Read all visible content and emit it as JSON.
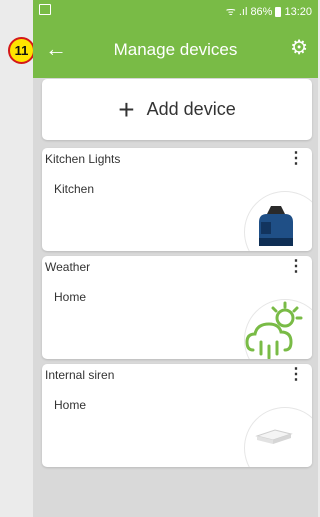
{
  "status_bar": {
    "signal": "ᯤ .ıl",
    "battery_pct": "86%",
    "time": "13:20"
  },
  "annotation": {
    "number": "11"
  },
  "app_bar": {
    "title": "Manage devices"
  },
  "add_device": {
    "label": "Add device"
  },
  "devices": [
    {
      "name": "Kitchen Lights",
      "location": "Kitchen",
      "icon": "relay-module-icon"
    },
    {
      "name": "Weather",
      "location": "Home",
      "icon": "weather-icon"
    },
    {
      "name": "Internal siren",
      "location": "Home",
      "icon": "siren-icon"
    }
  ],
  "colors": {
    "accent": "#79bb46",
    "background": "#d9d9d9",
    "badge": "#ffe400",
    "badge_border": "#d41818"
  }
}
